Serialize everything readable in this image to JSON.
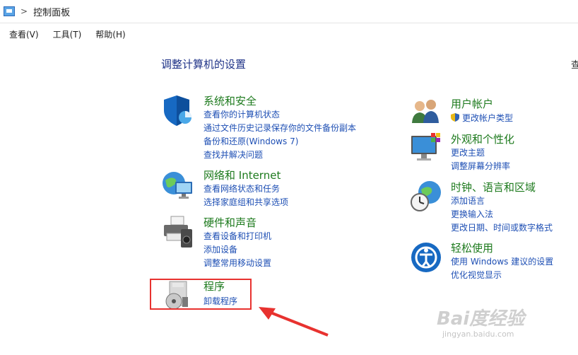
{
  "address": {
    "path": "控制面板",
    "separator": ">"
  },
  "menu": [
    "查看(V)",
    "工具(T)",
    "帮助(H)"
  ],
  "title": "调整计算机的设置",
  "view_by": "查",
  "categories": {
    "system_security": {
      "title": "系统和安全",
      "links": [
        "查看你的计算机状态",
        "通过文件历史记录保存你的文件备份副本",
        "备份和还原(Windows 7)",
        "查找并解决问题"
      ]
    },
    "network": {
      "title": "网络和 Internet",
      "links": [
        "查看网络状态和任务",
        "选择家庭组和共享选项"
      ]
    },
    "hardware": {
      "title": "硬件和声音",
      "links": [
        "查看设备和打印机",
        "添加设备",
        "调整常用移动设置"
      ]
    },
    "programs": {
      "title": "程序",
      "links": [
        "卸载程序"
      ]
    },
    "user_accounts": {
      "title": "用户帐户",
      "links": [
        "更改帐户类型"
      ]
    },
    "appearance": {
      "title": "外观和个性化",
      "links": [
        "更改主题",
        "调整屏幕分辨率"
      ]
    },
    "clock": {
      "title": "时钟、语言和区域",
      "links": [
        "添加语言",
        "更换输入法",
        "更改日期、时间或数字格式"
      ]
    },
    "ease": {
      "title": "轻松使用",
      "links": [
        "使用 Windows 建议的设置",
        "优化视觉显示"
      ]
    }
  },
  "watermark": {
    "logo": "Bai度经验",
    "site": "jingyan.baidu.com"
  },
  "colors": {
    "title_blue": "#1e3287",
    "category_green": "#1d7a1d",
    "link_blue": "#1e4fb4",
    "annotation_red": "#e8322f"
  }
}
